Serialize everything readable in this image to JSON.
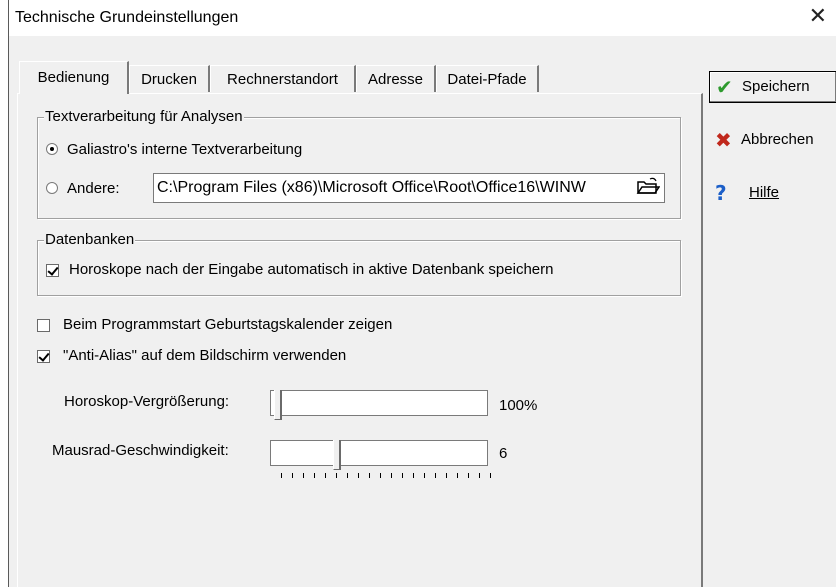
{
  "window": {
    "title": "Technische Grundeinstellungen",
    "close_glyph": "✕"
  },
  "tabs": [
    {
      "label": "Bedienung",
      "active": true
    },
    {
      "label": "Drucken",
      "active": false
    },
    {
      "label": "Rechnerstandort",
      "active": false
    },
    {
      "label": "Adresse",
      "active": false
    },
    {
      "label": "Datei-Pfade",
      "active": false
    }
  ],
  "text_processing": {
    "legend": "Textverarbeitung für Analysen",
    "option_internal": "Galiastro's interne Textverarbeitung",
    "option_other": "Andere:",
    "selected": "internal",
    "path_value": "C:\\Program Files (x86)\\Microsoft Office\\Root\\Office16\\WINW",
    "browse_icon": "folder-open-icon"
  },
  "databases": {
    "legend": "Datenbanken",
    "auto_save_label": "Horoskope nach der Eingabe automatisch in aktive Datenbank speichern",
    "auto_save_checked": true
  },
  "options": {
    "birthday_calendar_label": "Beim Programmstart Geburtstagskalender zeigen",
    "birthday_calendar_checked": false,
    "anti_alias_label": "\"Anti-Alias\" auf dem Bildschirm verwenden",
    "anti_alias_checked": true
  },
  "sliders": {
    "zoom_label": "Horoskop-Vergrößerung:",
    "zoom_value_text": "100%",
    "wheel_label": "Mausrad-Geschwindigkeit:",
    "wheel_value_text": "6"
  },
  "buttons": {
    "save_label": "Speichern",
    "cancel_label": "Abbrechen",
    "help_label": "Hilfe",
    "save_icon": "checkmark-icon",
    "cancel_icon": "x-icon",
    "help_icon": "question-icon",
    "colors": {
      "check": "#2e9a2e",
      "cross": "#c0281c",
      "help": "#1c5fc8"
    }
  }
}
